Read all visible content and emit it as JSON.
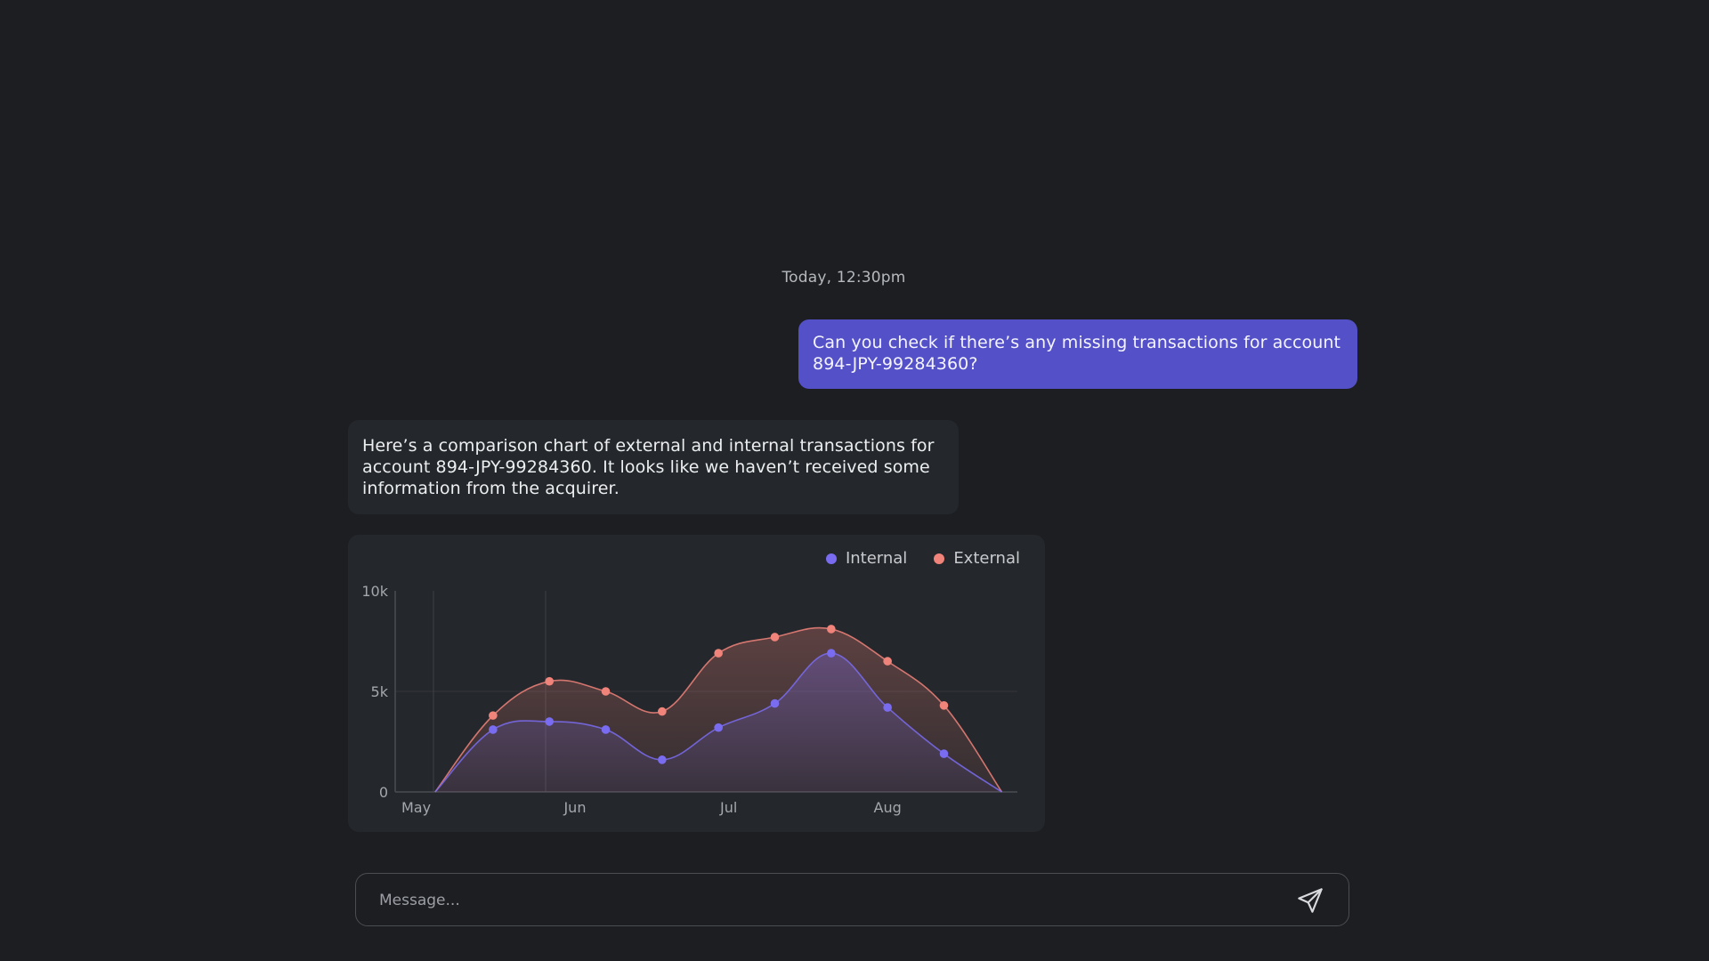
{
  "conversation": {
    "timestamp": "Today, 12:30pm",
    "user_message": "Can you check if there’s any missing transactions for account 894-JPY-99284360?",
    "bot_message": "Here’s a comparison chart of external and internal transactions for account 894-JPY-99284360. It looks like we haven’t received some information from the acquirer."
  },
  "composer": {
    "placeholder": "Message...",
    "send_icon": "send-icon"
  },
  "colors": {
    "background": "#1c1e21",
    "user_bubble": "#5450c8",
    "bot_bubble": "#24272b",
    "internal": "#7a6cf0",
    "external": "#f0837a"
  },
  "chart_data": {
    "type": "area",
    "legend_position": "top-right",
    "x_ticks": [
      "May",
      "Jun",
      "Jul",
      "Aug"
    ],
    "y_ticks": [
      "0",
      "5k",
      "10k"
    ],
    "ylim": [
      0,
      10000
    ],
    "grid": true,
    "series": [
      {
        "name": "Internal",
        "color": "#7a6cf0",
        "points": [
          {
            "x": "2024-05-16",
            "y": 3100
          },
          {
            "x": "2024-05-27",
            "y": 3500
          },
          {
            "x": "2024-06-07",
            "y": 3100
          },
          {
            "x": "2024-06-18",
            "y": 1600
          },
          {
            "x": "2024-06-29",
            "y": 3200
          },
          {
            "x": "2024-07-10",
            "y": 4400
          },
          {
            "x": "2024-07-21",
            "y": 6900
          },
          {
            "x": "2024-08-01",
            "y": 4200
          },
          {
            "x": "2024-08-12",
            "y": 1900
          }
        ]
      },
      {
        "name": "External",
        "color": "#f0837a",
        "points": [
          {
            "x": "2024-05-16",
            "y": 3800
          },
          {
            "x": "2024-05-27",
            "y": 5500
          },
          {
            "x": "2024-06-07",
            "y": 5000
          },
          {
            "x": "2024-06-18",
            "y": 4000
          },
          {
            "x": "2024-06-29",
            "y": 6900
          },
          {
            "x": "2024-07-10",
            "y": 7700
          },
          {
            "x": "2024-07-21",
            "y": 8100
          },
          {
            "x": "2024-08-01",
            "y": 6500
          },
          {
            "x": "2024-08-12",
            "y": 4300
          }
        ]
      }
    ]
  }
}
